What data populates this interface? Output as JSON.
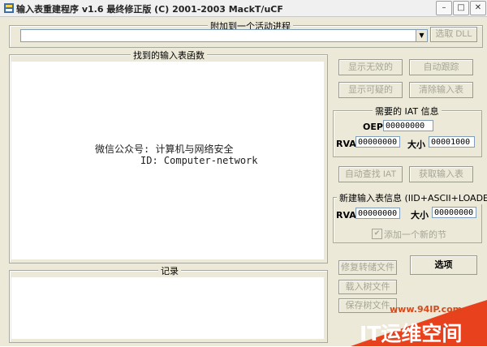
{
  "titlebar": {
    "title": "输入表重建程序 v1.6 最终修正版 (C) 2001-2003 MackT/uCF",
    "min_icon": "minimize-icon",
    "max_icon": "maximize-icon",
    "close_icon": "close-icon"
  },
  "attach": {
    "legend": "附加到一个活动进程",
    "select_dll_label": "选取 DLL"
  },
  "imports": {
    "legend": "找到的输入表函数",
    "line1": "微信公众号: 计算机与网络安全",
    "line2": "ID: Computer-network"
  },
  "buttons": {
    "show_invalid": "显示无效的",
    "auto_trace": "自动跟踪",
    "show_suspect": "显示可疑的",
    "clear_imports": "清除输入表",
    "iat_autosearch": "自动查找 IAT",
    "get_imports": "获取输入表",
    "fix_dump": "修复转储文件",
    "load_tree": "载入树文件",
    "save_tree": "保存树文件",
    "options": "选项"
  },
  "iat": {
    "legend": "需要的 IAT 信息",
    "oep_label": "OEP",
    "oep_value": "00000000",
    "rva_label": "RVA",
    "rva_value": "00000000",
    "size_label": "大小",
    "size_value": "00001000"
  },
  "new_import": {
    "legend": "新建输入表信息 (IID+ASCII+LOADER)",
    "rva_label": "RVA",
    "rva_value": "00000000",
    "size_label": "大小",
    "size_value": "00000000",
    "add_section_label": "添加一个新的节",
    "add_section_checked": true
  },
  "log": {
    "legend": "记录"
  },
  "watermark": {
    "url": "www.94IP.com",
    "brand": "IT运维空间",
    "color": "#e8411e"
  }
}
